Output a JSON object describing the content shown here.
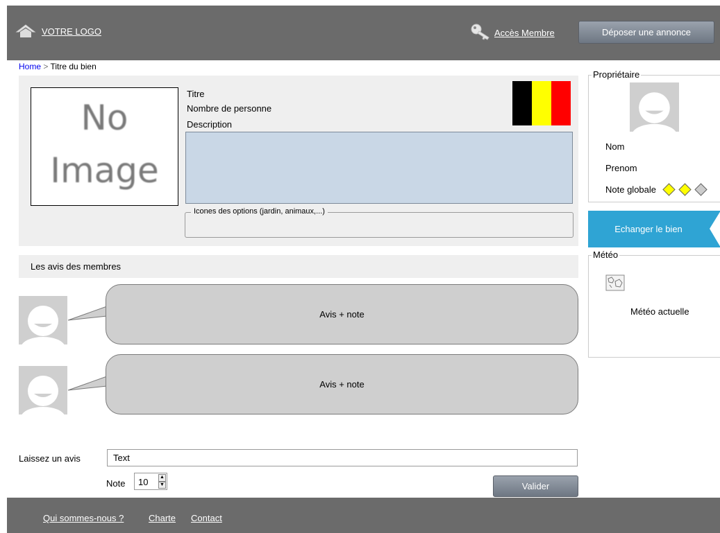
{
  "header": {
    "logo_text": "VOTRE LOGO",
    "member_link": "Accès Membre",
    "deposit_button": "Déposer une annonce"
  },
  "breadcrumb": {
    "home": "Home",
    "separator": " > ",
    "current": "Titre du bien"
  },
  "property": {
    "no_image_line1": "No",
    "no_image_line2": "Image",
    "title_label": "Titre",
    "persons_label": "Nombre de personne",
    "description_label": "Description",
    "options_legend": "Icones des options (jardin, animaux,...)",
    "flag_colors": [
      "#000000",
      "#ffff00",
      "#ff0000"
    ]
  },
  "reviews": {
    "title": "Les avis des membres",
    "items": [
      {
        "text": "Avis + note"
      },
      {
        "text": "Avis + note"
      }
    ]
  },
  "form": {
    "label": "Laissez un avis",
    "text_value": "Text",
    "note_label": "Note",
    "note_value": "10",
    "submit_label": "Valider"
  },
  "footer": {
    "links": [
      "Qui sommes-nous ?",
      "Charte",
      "Contact"
    ]
  },
  "owner": {
    "legend": "Propriétaire",
    "nom": "Nom",
    "prenom": "Prenom",
    "note_label": "Note globale",
    "rating": 2,
    "rating_max": 3,
    "rating_fill_color": "#ffff00"
  },
  "exchange_button": "Echanger le bien",
  "weather": {
    "legend": "Météo",
    "icon": "map-icon",
    "current": "Météo actuelle"
  },
  "colors": {
    "header_bg": "#6b6b6b",
    "accent": "#2fa4d4",
    "panel_bg": "#efefef",
    "description_bg": "#c9d7e6"
  }
}
